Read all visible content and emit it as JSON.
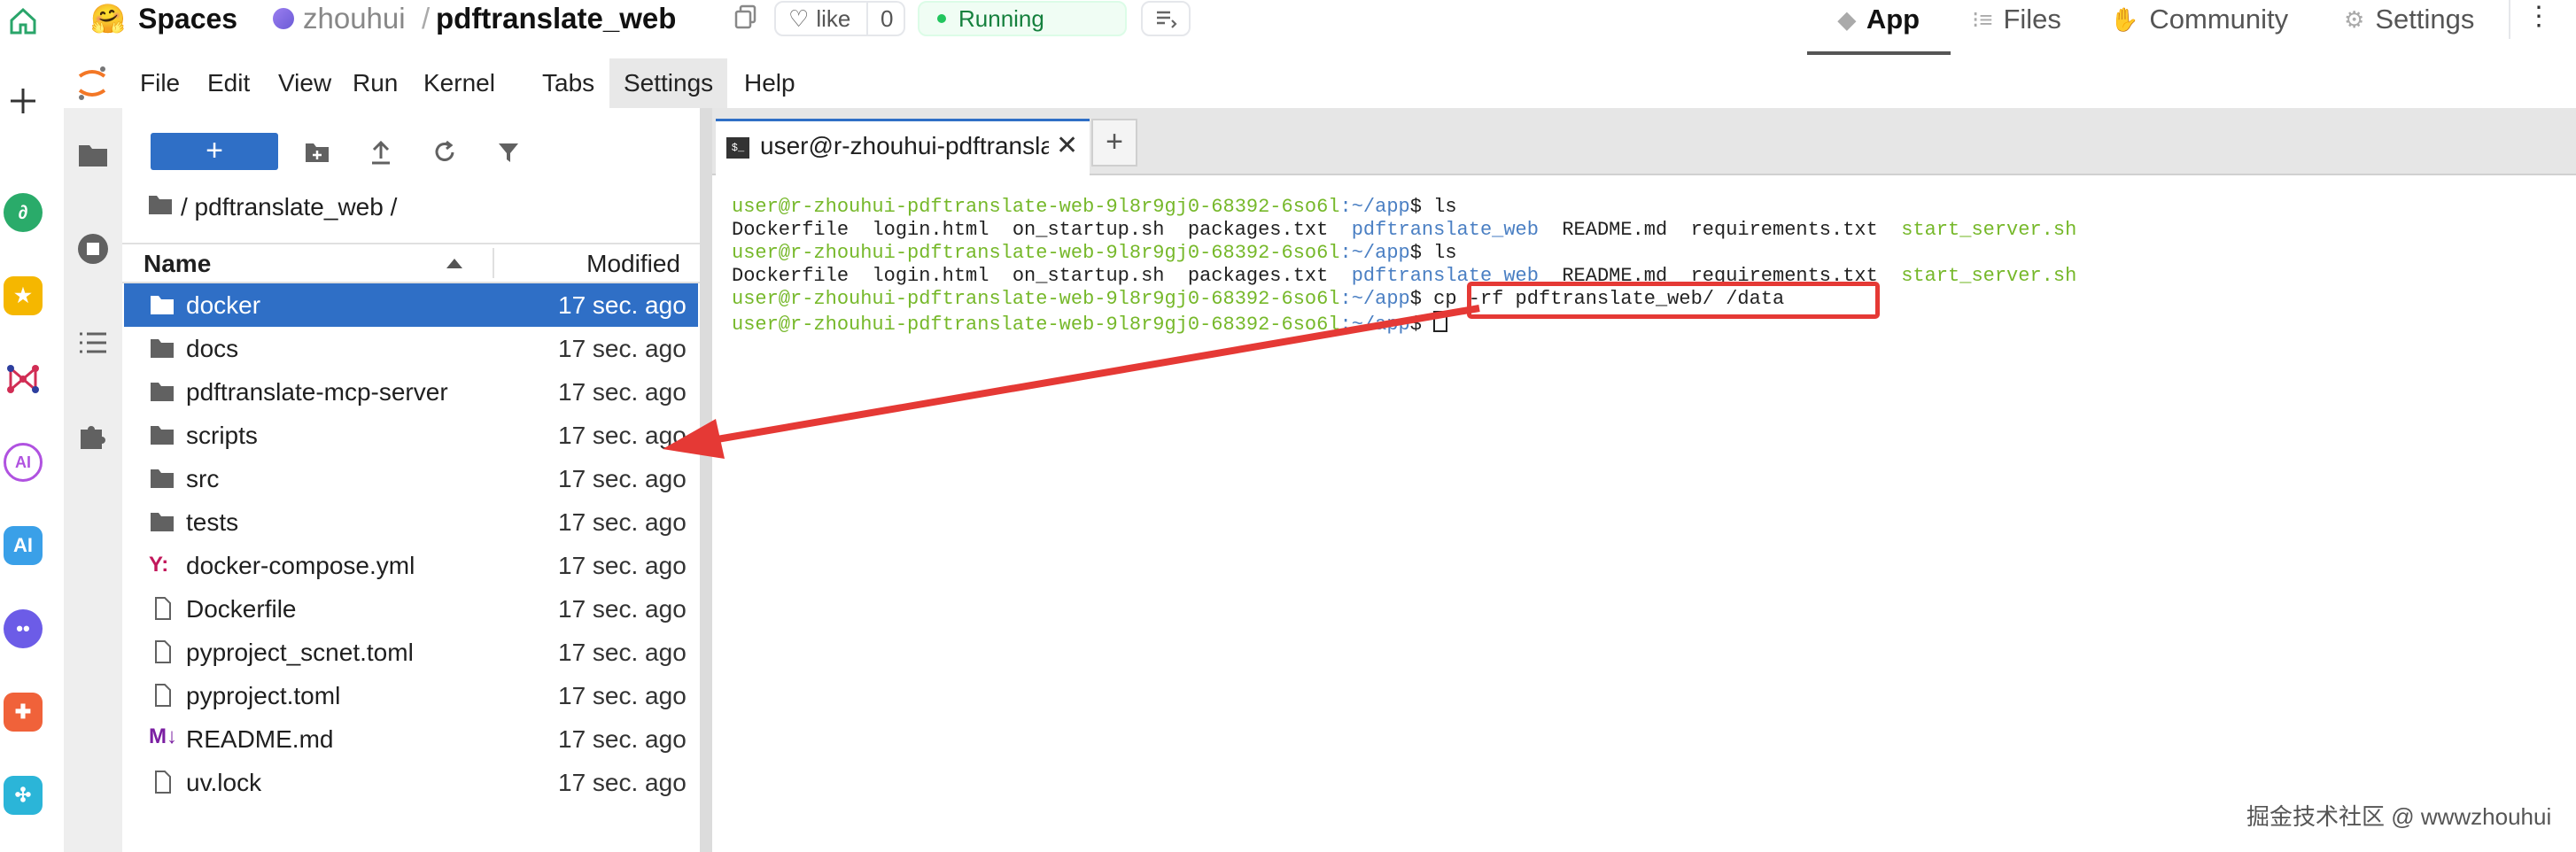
{
  "hf": {
    "spaces_label": "Spaces",
    "owner": "zhouhui",
    "separator": "/",
    "repo": "pdftranslate_web",
    "like_label": "like",
    "like_count": "0",
    "status": "Running",
    "tabs": [
      {
        "label": "App",
        "icon": "app-cube-icon"
      },
      {
        "label": "Files",
        "icon": "files-icon"
      },
      {
        "label": "Community",
        "icon": "community-icon"
      },
      {
        "label": "Settings",
        "icon": "settings-gear-icon"
      }
    ]
  },
  "menu": [
    "File",
    "Edit",
    "View",
    "Run",
    "Kernel",
    "Tabs",
    "Settings",
    "Help"
  ],
  "filebrowser": {
    "new_button": "+",
    "breadcrumb": "/ pdftranslate_web /",
    "col_name": "Name",
    "col_modified": "Modified",
    "items": [
      {
        "name": "docker",
        "modified": "17 sec. ago",
        "type": "folder"
      },
      {
        "name": "docs",
        "modified": "17 sec. ago",
        "type": "folder"
      },
      {
        "name": "pdftranslate-mcp-server",
        "modified": "17 sec. ago",
        "type": "folder"
      },
      {
        "name": "scripts",
        "modified": "17 sec. ago",
        "type": "folder"
      },
      {
        "name": "src",
        "modified": "17 sec. ago",
        "type": "folder"
      },
      {
        "name": "tests",
        "modified": "17 sec. ago",
        "type": "folder"
      },
      {
        "name": "docker-compose.yml",
        "modified": "17 sec. ago",
        "type": "yaml"
      },
      {
        "name": "Dockerfile",
        "modified": "17 sec. ago",
        "type": "file"
      },
      {
        "name": "pyproject_scnet.toml",
        "modified": "17 sec. ago",
        "type": "file"
      },
      {
        "name": "pyproject.toml",
        "modified": "17 sec. ago",
        "type": "file"
      },
      {
        "name": "README.md",
        "modified": "17 sec. ago",
        "type": "markdown"
      },
      {
        "name": "uv.lock",
        "modified": "17 sec. ago",
        "type": "file"
      }
    ]
  },
  "terminal": {
    "tab_title": "user@r-zhouhui-pdftransla",
    "add_tab": "+",
    "prompt_user": "user@r-zhouhui-pdftranslate-web-9l8r9gj0-68392-6so6l",
    "prompt_path": ":~/app",
    "lines": {
      "l1_cmd": "$ ls",
      "l2_a": "Dockerfile  login.html  on_startup.sh  packages.txt  ",
      "l2_b": "pdftranslate_web",
      "l2_c": "  README.md  requirements.txt  ",
      "l2_d": "start_server.sh",
      "l3_cmd": "$ ls",
      "l5_cmd": "$ cp -rf pdftranslate_web/ /data",
      "l6_cmd": "$ "
    }
  },
  "watermark": "掘金技术社区 @ wwwzhouhui",
  "colors": {
    "selection": "#2f6fc6",
    "new_button": "#2f6fc6",
    "prompt_green": "#76b82a",
    "dir_blue": "#4a7fc3",
    "annotation_red": "#e53935",
    "running_green": "#22c55e"
  }
}
